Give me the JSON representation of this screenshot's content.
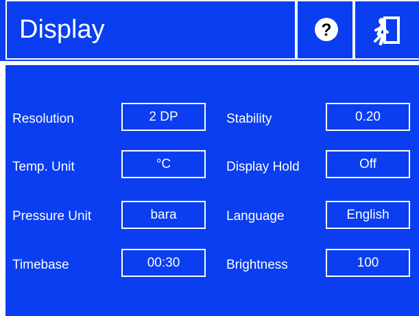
{
  "header": {
    "title": "Display",
    "help_icon": "question-mark-circle-icon",
    "exit_icon": "emergency-exit-running-man-icon"
  },
  "colors": {
    "background": "#0a3ef0",
    "foreground": "#ffffff"
  },
  "settings": {
    "resolution": {
      "label": "Resolution",
      "value": "2 DP"
    },
    "temp_unit": {
      "label": "Temp. Unit",
      "value": "°C"
    },
    "pressure_unit": {
      "label": "Pressure Unit",
      "value": "bara"
    },
    "timebase": {
      "label": "Timebase",
      "value": "00:30"
    },
    "stability": {
      "label": "Stability",
      "value": "0.20"
    },
    "display_hold": {
      "label": "Display Hold",
      "value": "Off"
    },
    "language": {
      "label": "Language",
      "value": "English"
    },
    "brightness": {
      "label": "Brightness",
      "value": "100"
    }
  }
}
